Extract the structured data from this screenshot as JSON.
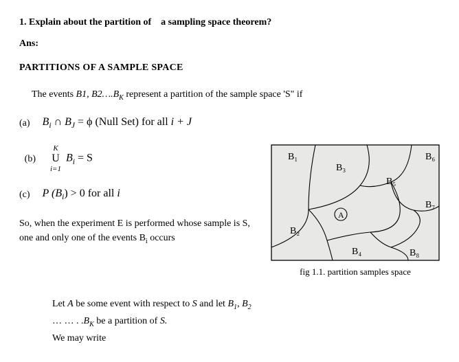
{
  "q": {
    "title_prefix": "1. Explain about the partition of",
    "title_suffix": "a sampling space theorem?",
    "ans_label": "Ans:",
    "section_title": "PARTITIONS OF A SAMPLE SPACE",
    "intro_pre": "The events ",
    "intro_events": "B1, B2….B",
    "intro_sub": "K",
    "intro_post": " represent a partition of the sample space 'S\" if"
  },
  "cond_a": {
    "letter": "(a)",
    "lhs1": "B",
    "sub1": "i",
    "cap": " ∩ ",
    "lhs2": "B",
    "sub2": "J",
    "eq": " = ϕ (Null Set) for all ",
    "tail": "i + J"
  },
  "cond_b": {
    "letter": "(b)",
    "top": "K",
    "mid": "U",
    "bot": "i=1",
    "rhs": "B",
    "rhs_sub": "i",
    "eq": " = S"
  },
  "cond_c": {
    "letter": "(c)",
    "body_pre": "P (B",
    "body_sub": "i",
    "body_mid": ") > 0 for all ",
    "body_tail": "i"
  },
  "so": {
    "line1": "So, when the experiment E is performed whose sample is S,",
    "line2_pre": "one and only one of the events B",
    "line2_sub": "i",
    "line2_post": " occurs"
  },
  "let": {
    "l1_pre": "Let ",
    "l1_A": "A",
    "l1_mid": " be some event with respect to ",
    "l1_S": "S",
    "l1_andlet": " and let   ",
    "l1_B1": "B",
    "l1_B1s": "1",
    "l1_comma": ", ",
    "l1_B2": "B",
    "l1_B2s": "2",
    "l2_dots": "… … . .",
    "l2_BK": "B",
    "l2_BKs": "K",
    "l2_rest": " be a partition of ",
    "l2_S": "S.",
    "l3": "We may write"
  },
  "fig": {
    "caption": "fig 1.1. partition samples space",
    "labels": {
      "b1": "B₁",
      "b2": "B₂",
      "b3": "B₃",
      "b4": "B₄",
      "b5": "B₅",
      "b6": "B₆",
      "b7": "B₇",
      "b8": "B₈",
      "a": "A"
    }
  }
}
